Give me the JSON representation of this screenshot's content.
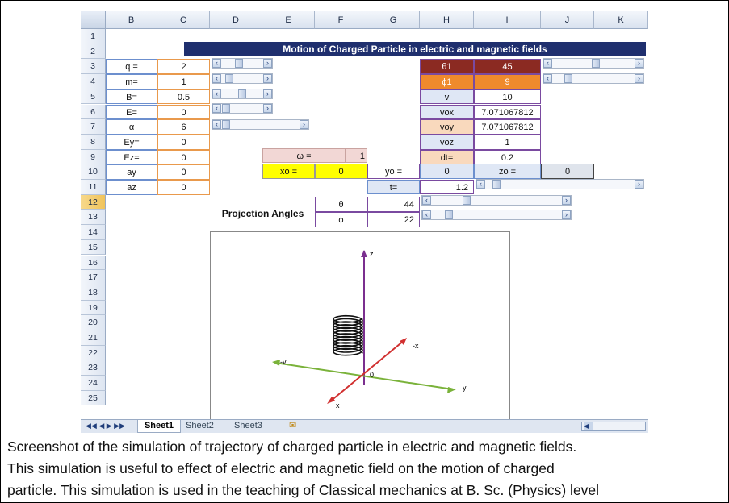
{
  "columns": [
    "B",
    "C",
    "D",
    "E",
    "F",
    "G",
    "H",
    "I",
    "J",
    "K"
  ],
  "rows": [
    "1",
    "2",
    "3",
    "4",
    "5",
    "6",
    "7",
    "8",
    "9",
    "10",
    "11",
    "12",
    "13",
    "14",
    "15",
    "16",
    "17",
    "18",
    "19",
    "20",
    "21",
    "22",
    "23",
    "24",
    "25"
  ],
  "title": "Motion of Charged Particle in electric and magnetic fields",
  "params": [
    {
      "label": "q =",
      "value": "2"
    },
    {
      "label": "m=",
      "value": "1"
    },
    {
      "label": "B=",
      "value": "0.5"
    },
    {
      "label": "E=",
      "value": "0"
    },
    {
      "label": "α",
      "value": "6"
    },
    {
      "label": "Ey=",
      "value": "0"
    },
    {
      "label": "Ez=",
      "value": "0"
    },
    {
      "label": "ay",
      "value": "0"
    },
    {
      "label": "az",
      "value": "0"
    }
  ],
  "right_params": [
    {
      "label": "θ1",
      "value": "45"
    },
    {
      "label": "ϕ1",
      "value": "9"
    },
    {
      "label": "v",
      "value": "10"
    },
    {
      "label": "vox",
      "value": "7.071067812"
    },
    {
      "label": "voy",
      "value": "7.071067812"
    },
    {
      "label": "voz",
      "value": "1"
    },
    {
      "label": "dt=",
      "value": "0.2"
    }
  ],
  "omega": {
    "label": "ω =",
    "value": "1"
  },
  "x0": {
    "label": "xo =",
    "value": "0"
  },
  "y0": {
    "label": "yo =",
    "value": "0"
  },
  "z0": {
    "label": "zo =",
    "value": "0"
  },
  "t": {
    "label": "t=",
    "value": "1.2"
  },
  "projection": {
    "label": "Projection Angles",
    "theta_label": "θ",
    "theta": "44",
    "phi_label": "ϕ",
    "phi": "22"
  },
  "axes": {
    "z": "z",
    "negx": "-x",
    "negy": "-v",
    "y": "y",
    "x": "x",
    "origin": "0"
  },
  "sheets": [
    "Sheet1",
    "Sheet2",
    "Sheet3"
  ],
  "caption": [
    "Screenshot of the simulation of trajectory of charged particle in electric and magnetic fields.",
    "This simulation is useful to effect of electric and magnetic field on the motion of charged",
    "particle. This simulation is used in the teaching of Classical mechanics at B. Sc. (Physics) level"
  ],
  "colors": {
    "title_bg": "#1f2f6e",
    "theta_bg": "#8b2a22",
    "phi_bg": "#ef8a2c",
    "yellow": "#ffff00",
    "label_blue": "#dfe7f5",
    "peach": "#f9d9bd",
    "pink": "#f2d7d5"
  }
}
